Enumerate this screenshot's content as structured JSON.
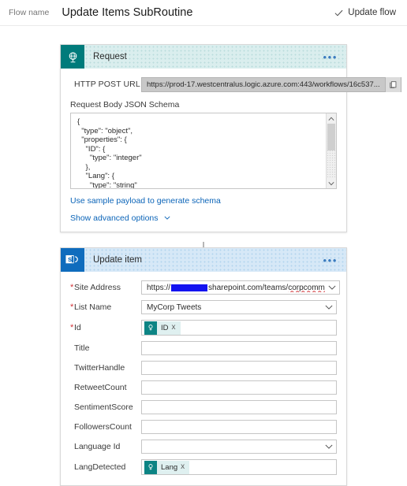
{
  "topbar": {
    "flow_name_label": "Flow name",
    "flow_title": "Update Items SubRoutine",
    "update_flow_label": "Update flow",
    "check_icon": "check-icon"
  },
  "colors": {
    "request_accent": "#007b7b",
    "sharepoint_accent": "#0f6cbd",
    "link": "#0b64b8",
    "required_asterisk": "#d13438",
    "token_chip_bg": "#dff0f0",
    "token_chip_icon": "#0c8484",
    "redaction": "#1313f0"
  },
  "request_card": {
    "title": "Request",
    "icon": "globe-request-icon",
    "menu_label": "•••",
    "http_post_url": {
      "label": "HTTP POST URL",
      "value": "https://prod-17.westcentralus.logic.azure.com:443/workflows/16c537...",
      "copy_icon": "copy-icon"
    },
    "schema": {
      "label": "Request Body JSON Schema",
      "value": "{\n  \"type\": \"object\",\n  \"properties\": {\n    \"ID\": {\n      \"type\": \"integer\"\n    },\n    \"Lang\": {\n      \"type\": \"string\"\n    }\n  }"
    },
    "sample_payload_link": "Use sample payload to generate schema",
    "advanced_options_link": "Show advanced options"
  },
  "connector": {
    "icon": "down-arrow-icon"
  },
  "update_item_card": {
    "title": "Update item",
    "icon": "sharepoint-icon",
    "menu_label": "•••",
    "fields": [
      {
        "label": "Site Address",
        "required": true,
        "type": "dropdown",
        "value_prefix": "https://",
        "value_redacted": true,
        "value_suffix": "sharepoint.com/teams/",
        "value_suffix_misspelled": "corpcomm"
      },
      {
        "label": "List Name",
        "required": true,
        "type": "dropdown",
        "value": "MyCorp Tweets"
      },
      {
        "label": "Id",
        "required": true,
        "type": "token",
        "token_label": "ID",
        "token_icon": "dynamic-content-icon",
        "token_remove": "x"
      },
      {
        "label": "Title",
        "required": false,
        "type": "text",
        "value": ""
      },
      {
        "label": "TwitterHandle",
        "required": false,
        "type": "text",
        "value": ""
      },
      {
        "label": "RetweetCount",
        "required": false,
        "type": "text",
        "value": ""
      },
      {
        "label": "SentimentScore",
        "required": false,
        "type": "text",
        "value": ""
      },
      {
        "label": "FollowersCount",
        "required": false,
        "type": "text",
        "value": ""
      },
      {
        "label": "Language Id",
        "required": false,
        "type": "dropdown",
        "value": ""
      },
      {
        "label": "LangDetected",
        "required": false,
        "type": "token",
        "token_label": "Lang",
        "token_icon": "dynamic-content-icon",
        "token_remove": "x"
      }
    ]
  }
}
